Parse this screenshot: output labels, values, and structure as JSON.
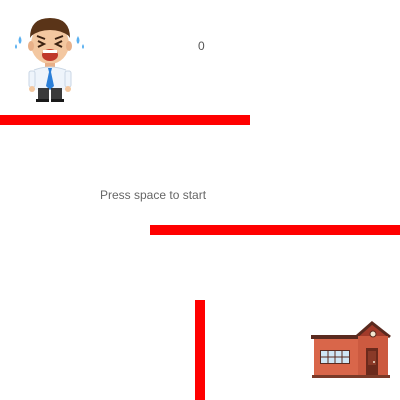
{
  "hud": {
    "score": "0"
  },
  "message": {
    "prompt": "Press space to start"
  },
  "player": {
    "icon": "crying-businessman-icon"
  },
  "goal": {
    "icon": "school-house-icon"
  },
  "walls": [
    {
      "name": "wall-top-left",
      "color": "#ff0000"
    },
    {
      "name": "wall-middle-right",
      "color": "#ff0000"
    },
    {
      "name": "wall-bottom-vertical",
      "color": "#ff0000"
    }
  ],
  "colors": {
    "wall": "#ff0000",
    "background": "#ffffff"
  }
}
